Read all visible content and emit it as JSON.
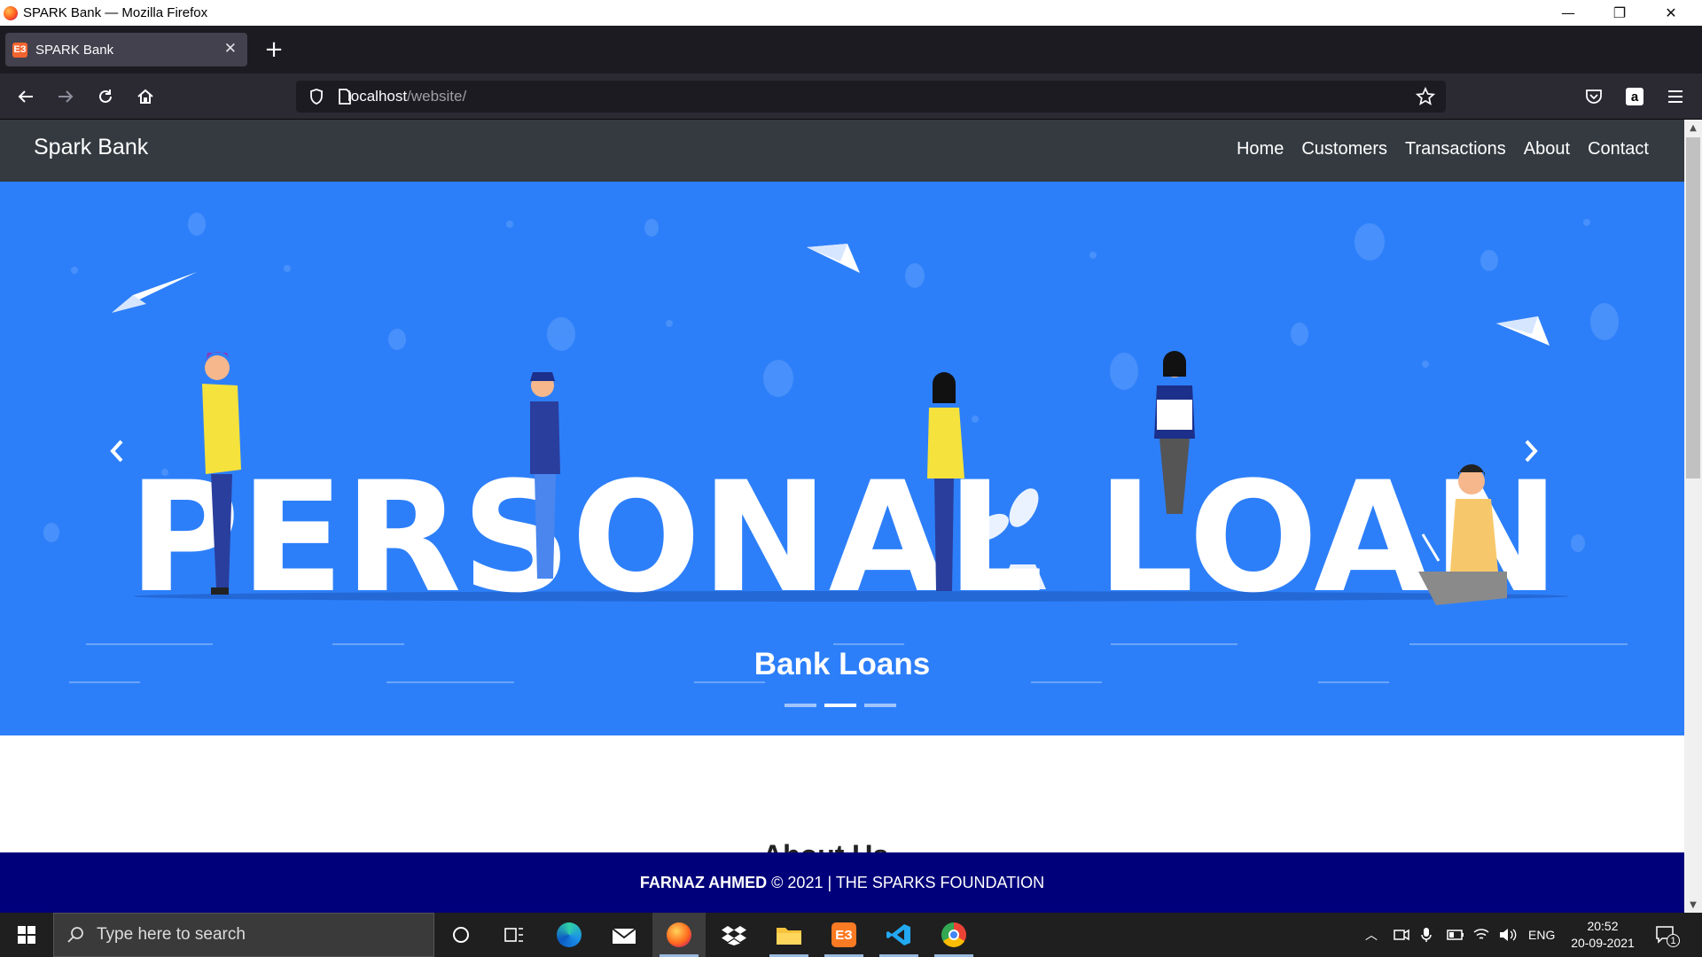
{
  "window": {
    "title": "SPARK Bank — Mozilla Firefox",
    "controls": {
      "minimize": "—",
      "restore": "❐",
      "close": "✕"
    }
  },
  "tabs": [
    {
      "label": "SPARK Bank",
      "icon": "xampp-favicon",
      "active": true
    }
  ],
  "toolbar": {
    "url_host": "localhost",
    "url_path": "/website/"
  },
  "site": {
    "brand": "Spark Bank",
    "nav": [
      "Home",
      "Customers",
      "Transactions",
      "About",
      "Contact"
    ],
    "carousel": {
      "banner_text": "PERSONAL LOAN",
      "caption": "Bank Loans",
      "slide_count": 3,
      "active_slide": 2
    },
    "section_peek": "About Us",
    "footer": {
      "name": "FARNAZ AHMED",
      "rest": " © 2021 | THE SPARKS FOUNDATION"
    }
  },
  "taskbar": {
    "search_placeholder": "Type here to search",
    "language": "ENG",
    "time": "20:52",
    "date": "20-09-2021",
    "notification_count": "1"
  },
  "colors": {
    "hero_blue": "#2d7ff9",
    "site_nav": "#343a40",
    "footer": "#00007a"
  }
}
